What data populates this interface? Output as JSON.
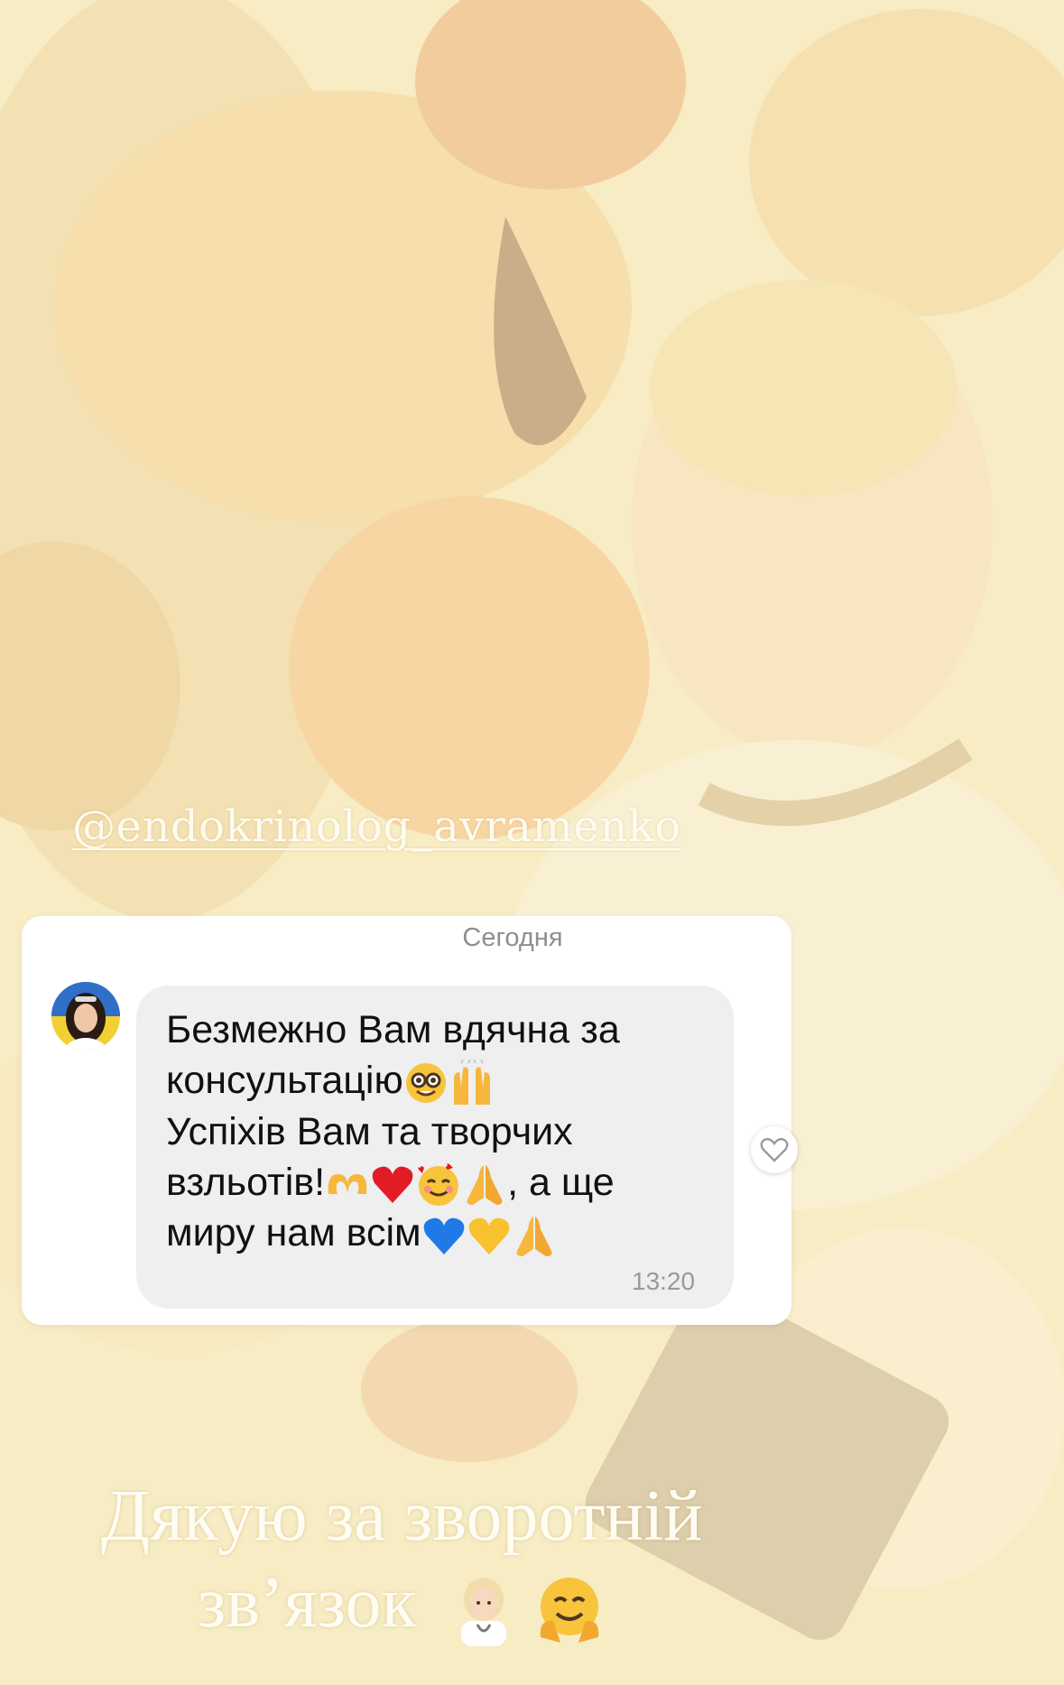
{
  "story": {
    "mention": "@endokrinolog_avramenko",
    "caption_line1": "Дякую за зворотній",
    "caption_line2": "зв’язок",
    "caption_emojis": [
      "woman-health-worker-emoji",
      "hugging-face-emoji"
    ]
  },
  "chat": {
    "date_label": "Сегодня",
    "message": {
      "line1": "Безмежно Вам вдячна за",
      "line2": "консультацію",
      "line3": "Успіхів Вам та творчих",
      "line4": "взльотів!",
      "line4_suffix": ", а ще",
      "line5": "миру нам всім",
      "time": "13:20"
    },
    "line2_emojis": [
      "nerd-face-emoji",
      "raising-hands-emoji"
    ],
    "line4_emojis": [
      "heart-hands-emoji",
      "red-heart-emoji",
      "smiling-face-with-hearts-emoji",
      "folded-hands-emoji"
    ],
    "line5_emojis": [
      "blue-heart-emoji",
      "yellow-heart-emoji",
      "folded-hands-emoji"
    ],
    "avatar": "avatar",
    "like_icon": "heart-outline-icon"
  },
  "colors": {
    "bubble": "#efefef",
    "card": "#ffffff",
    "overlay_text": "#fffdf3",
    "meta_text": "#8e8e93"
  }
}
